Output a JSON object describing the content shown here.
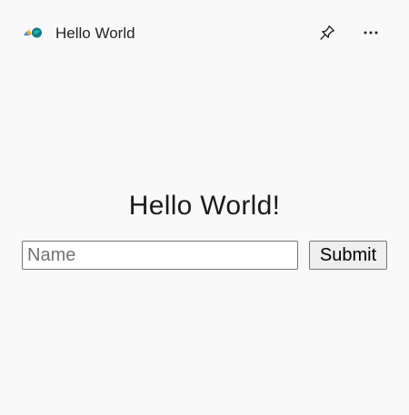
{
  "titlebar": {
    "app_title": "Hello World",
    "app_icon": "app-logo-icon",
    "pin_icon": "pin-icon",
    "more_icon": "more-options-icon"
  },
  "main": {
    "heading": "Hello World!",
    "name_input": {
      "placeholder": "Name",
      "value": ""
    },
    "submit_label": "Submit"
  },
  "colors": {
    "background": "#f9f9f9",
    "text": "#1b1b1b",
    "input_border": "#767676",
    "button_background": "#efefef"
  }
}
